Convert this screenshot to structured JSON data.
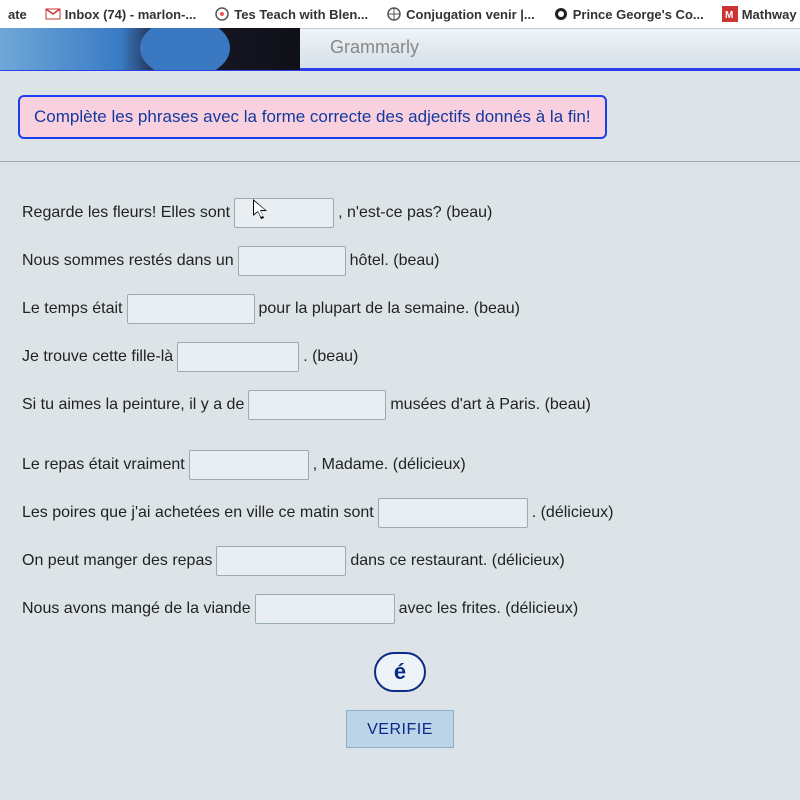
{
  "bookmarks": {
    "ate": "ate",
    "gmail": "Inbox (74) - marlon-...",
    "tes": "Tes Teach with Blen...",
    "conj": "Conjugation venir |...",
    "pg": "Prince George's Co...",
    "mathway": "Mathway | A"
  },
  "header_title": "Grammarly",
  "instruction": "Complète les phrases avec la forme correcte des adjectifs donnés à la fin!",
  "lines": [
    {
      "pre": "Regarde les fleurs! Elles sont",
      "post": ", n'est-ce pas? (beau)",
      "value": "",
      "cls": "w1"
    },
    {
      "pre": "Nous sommes restés dans un",
      "post": "hôtel. (beau)",
      "value": "",
      "cls": "w2"
    },
    {
      "pre": "Le temps était",
      "post": "pour la plupart de la semaine. (beau)",
      "value": "",
      "cls": "w3"
    },
    {
      "pre": "Je trouve cette fille-là",
      "post": ". (beau)",
      "value": "",
      "cls": "w4"
    },
    {
      "pre": "Si tu aimes la peinture, il y a de",
      "post": "musées d'art à Paris. (beau)",
      "value": "",
      "cls": "w5"
    },
    {
      "pre": "Le repas était vraiment",
      "post": ", Madame. (délicieux)",
      "value": "",
      "cls": "w6"
    },
    {
      "pre": "Les poires que j'ai achetées en ville ce matin sont",
      "post": ". (délicieux)",
      "value": "",
      "cls": "w7"
    },
    {
      "pre": "On peut manger des repas",
      "post": "dans ce restaurant. (délicieux)",
      "value": "",
      "cls": "w8"
    },
    {
      "pre": "Nous avons mangé de la viande",
      "post": "avec les frites. (délicieux)",
      "value": "",
      "cls": "w9"
    }
  ],
  "buttons": {
    "accent": "é",
    "verify": "VERIFIE"
  }
}
